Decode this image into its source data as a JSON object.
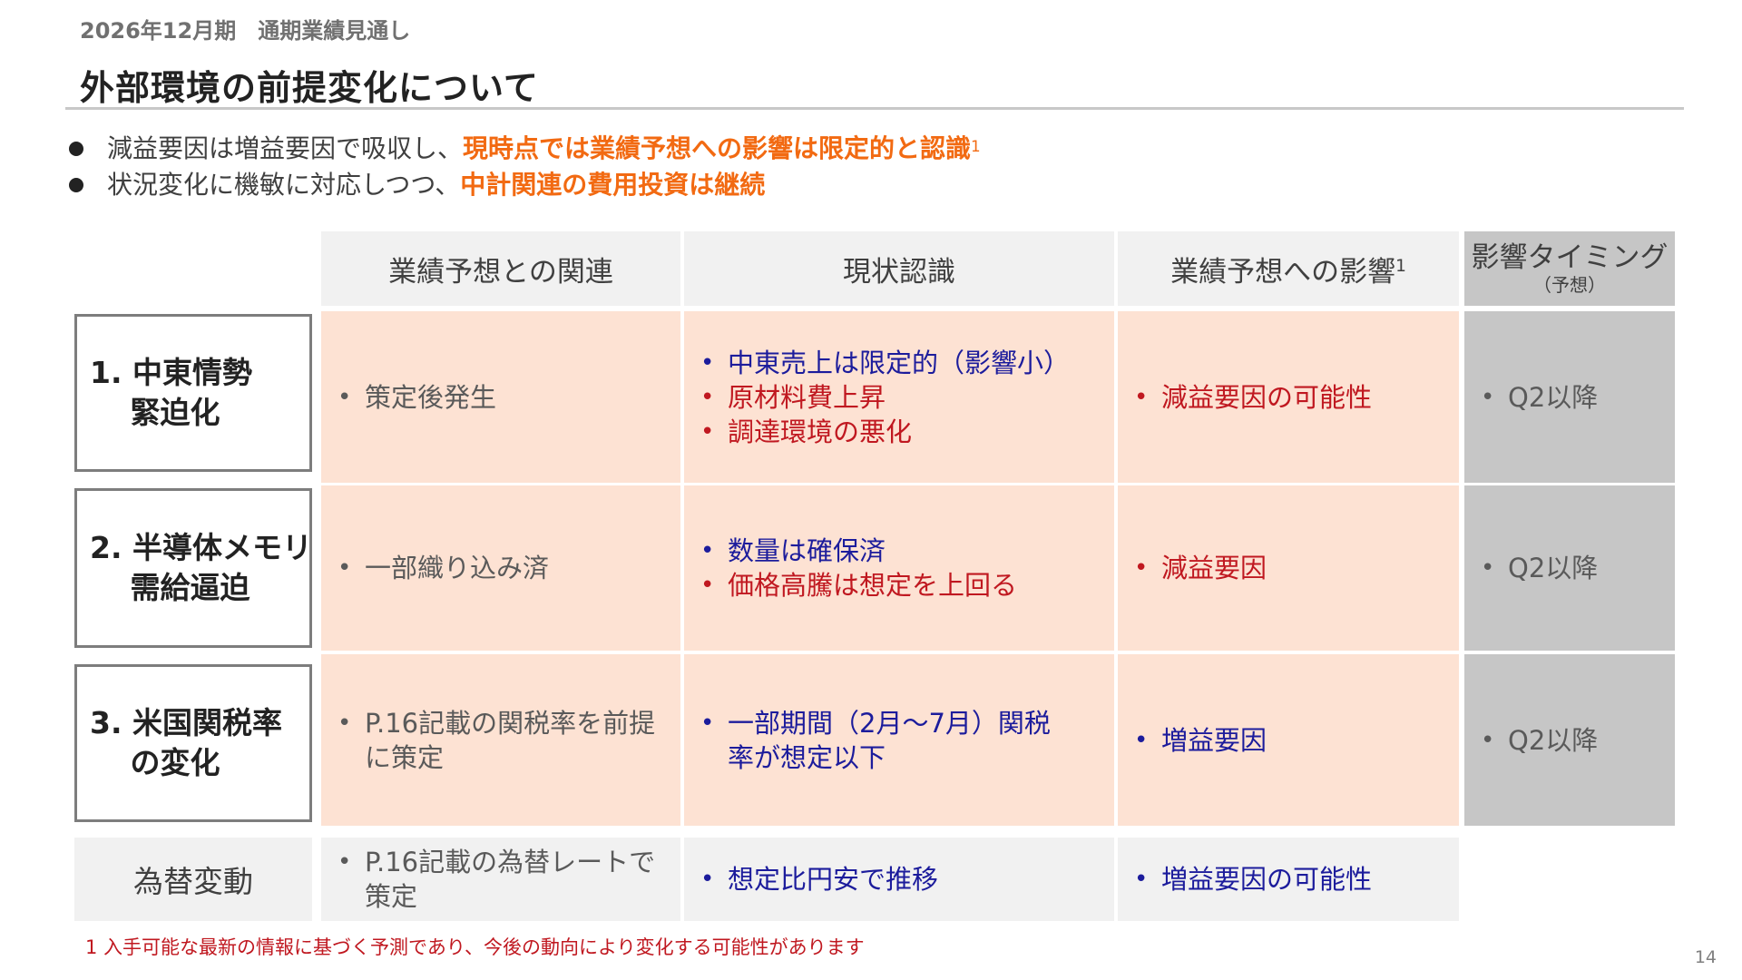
{
  "header": {
    "supertitle": "2026年12月期　通期業績見通し",
    "title": "外部環境の前提変化について"
  },
  "bullets": [
    {
      "normal": "減益要因は増益要因で吸収し、",
      "highlight": "現時点では業績予想への影響は限定的と認識",
      "sup": "1"
    },
    {
      "normal": "状況変化に機敏に対応しつつ、",
      "highlight": "中計関連の費用投資は継続",
      "sup": ""
    }
  ],
  "table": {
    "headers": {
      "col1": "業績予想との関連",
      "col2": "現状認識",
      "col3": "業績予想への影響",
      "col3_sup": "1",
      "col4": "影響タイミング",
      "col4_sub": "（予想）"
    },
    "rows": [
      {
        "label": "1. 中東情勢\n　 緊迫化",
        "relation": [
          "策定後発生"
        ],
        "status": [
          {
            "text": "中東売上は限定的（影響小）",
            "tone": "blue"
          },
          {
            "text": "原材料費上昇",
            "tone": "red"
          },
          {
            "text": "調達環境の悪化",
            "tone": "red"
          }
        ],
        "impact": {
          "text": "減益要因の可能性",
          "tone": "red"
        },
        "timing": "Q2以降"
      },
      {
        "label": "2. 半導体メモリ\n　 需給逼迫",
        "relation": [
          "一部織り込み済"
        ],
        "status": [
          {
            "text": "数量は確保済",
            "tone": "blue"
          },
          {
            "text": "価格高騰は想定を上回る",
            "tone": "red"
          }
        ],
        "impact": {
          "text": "減益要因",
          "tone": "red"
        },
        "timing": "Q2以降"
      },
      {
        "label": "3. 米国関税率\n　 の変化",
        "relation": [
          "P.16記載の関税率を前提\nに策定"
        ],
        "status": [
          {
            "text": "一部期間（2月～7月）関税\n率が想定以下",
            "tone": "blue"
          }
        ],
        "impact": {
          "text": "増益要因",
          "tone": "blue"
        },
        "timing": "Q2以降"
      }
    ],
    "fx_row": {
      "label": "為替変動",
      "relation": "P.16記載の為替レートで\n策定",
      "status": "想定比円安で推移",
      "impact": "増益要因の可能性"
    }
  },
  "footnote": "1 入手可能な最新の情報に基づく予測であり、今後の動向により変化する可能性があります",
  "page_number": "14",
  "colors": {
    "accent_orange": "#f26a12",
    "positive_blue": "#1c1c9c",
    "negative_red": "#c01820",
    "peach_fill": "#fde2d3",
    "gray_fill": "#c6c6c6"
  }
}
